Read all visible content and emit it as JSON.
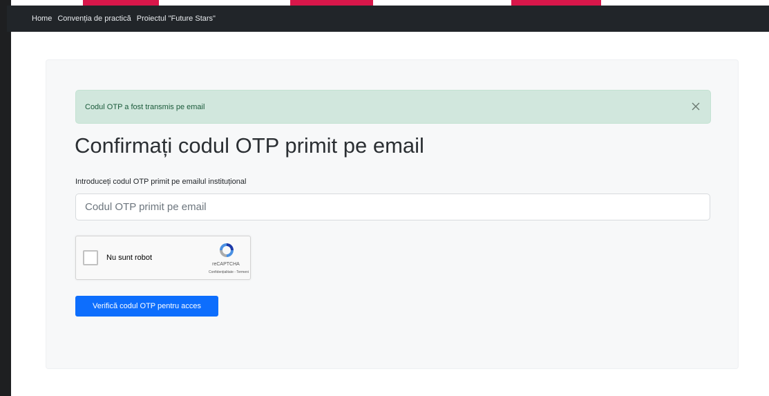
{
  "navbar": {
    "items": [
      {
        "label": "Home"
      },
      {
        "label": "Convenția de practică"
      },
      {
        "label": "Proiectul \"Future Stars\""
      }
    ]
  },
  "alert": {
    "text": "Codul OTP a fost transmis pe email",
    "close_icon": "close-icon"
  },
  "page": {
    "title": "Confirmați codul OTP primit pe email"
  },
  "otp_field": {
    "label": "Introduceți codul OTP primit pe emailul instituțional",
    "value": "",
    "placeholder": "Codul OTP primit pe email"
  },
  "captcha": {
    "label": "Nu sunt robot",
    "brand": "reCAPTCHA",
    "terms": "Confidențialitate - Termeni",
    "logo_icon": "recaptcha-logo-icon"
  },
  "verify_button": {
    "label": "Verifică codul OTP pentru acces"
  },
  "colors": {
    "navbar_bg": "#212529",
    "alert_bg": "#d1e7dd",
    "primary": "#0d6efd",
    "background_stripes": "#d8174a"
  }
}
